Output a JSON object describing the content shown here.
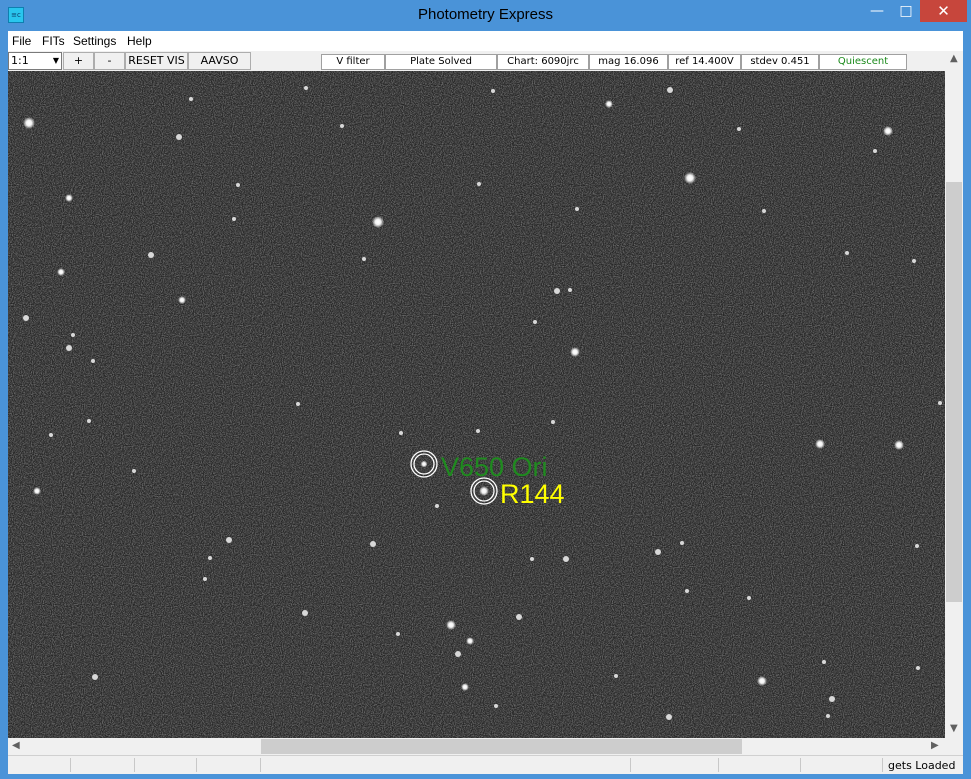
{
  "window": {
    "title": "Photometry Express"
  },
  "menu": {
    "items": [
      "File",
      "FITs",
      "Settings",
      "Help"
    ]
  },
  "toolbar": {
    "zoom_value": "1:1",
    "buttons": [
      "+",
      "-",
      "RESET VIS",
      "AAVSO"
    ]
  },
  "status_panels": {
    "filter": "V filter",
    "plate": "Plate Solved",
    "chart": "Chart: 6090jrc",
    "mag": "mag 16.096",
    "ref": "ref 14.400V",
    "stdev": "stdev 0.451",
    "state": "Quiescent"
  },
  "colors": {
    "state": "#1a8a1a",
    "target_label": "#1f8a1f",
    "ref_label": "#ffff00"
  },
  "targets": {
    "variable": "V650 Ori",
    "reference": "R144"
  },
  "statusbar": {
    "text": "gets Loaded"
  },
  "icons": {
    "app": "app-icon",
    "minimize": "minimize-icon",
    "maximize": "maximize-icon",
    "close": "close-icon"
  }
}
